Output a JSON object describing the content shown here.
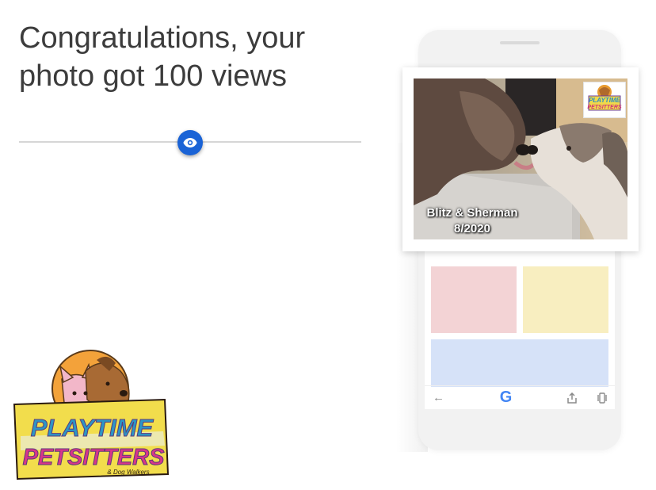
{
  "headline": {
    "line1": "Congratulations, your",
    "line2": "photo got 100 views"
  },
  "progress": {
    "fill_fraction": 0.5,
    "track_color": "#d6d6d6",
    "knob_color": "#1a63d6",
    "knob_icon": "eye-icon"
  },
  "photo": {
    "caption_line1": "Blitz & Sherman",
    "caption_line2": "8/2020"
  },
  "logo": {
    "line1": "PLAYTIME",
    "line2": "PETSITTERS",
    "tagline": "& Dog Walkers"
  },
  "phone": {
    "nav_back_icon": "back-arrow-icon",
    "nav_logo": "G",
    "nav_share_icon": "share-icon",
    "nav_tabs_icon": "tabs-icon",
    "block_colors": [
      "#f7e9b5",
      "#d6e2f8",
      "#f3d3d5",
      "#f8eec0",
      "#d6e2f8"
    ]
  }
}
